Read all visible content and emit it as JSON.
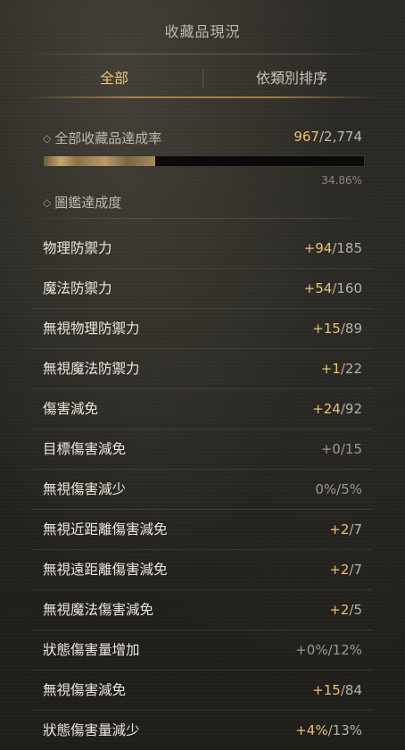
{
  "window": {
    "title": "收藏品現況"
  },
  "tabs": [
    {
      "label": "全部",
      "active": true
    },
    {
      "label": "依類別排序",
      "active": false
    }
  ],
  "collection_rate": {
    "label": "全部收藏品達成率",
    "current": "967",
    "total": "2,774",
    "percent_text": "34.86%",
    "progress": 0.3486
  },
  "codex": {
    "label": "圖鑑達成度"
  },
  "icons": {
    "bullet": "diamond-icon"
  },
  "colors": {
    "accent": "#e9c46e",
    "text": "#ebe6dc",
    "muted": "#9e988c"
  },
  "stats": [
    {
      "name": "物理防禦力",
      "current": "+94",
      "max": "185",
      "highlight": true
    },
    {
      "name": "魔法防禦力",
      "current": "+54",
      "max": "160",
      "highlight": true
    },
    {
      "name": "無視物理防禦力",
      "current": "+15",
      "max": "89",
      "highlight": true
    },
    {
      "name": "無視魔法防禦力",
      "current": "+1",
      "max": "22",
      "highlight": true
    },
    {
      "name": "傷害減免",
      "current": "+24",
      "max": "92",
      "highlight": true
    },
    {
      "name": "目標傷害減免",
      "current": "+0",
      "max": "15",
      "highlight": false
    },
    {
      "name": "無視傷害減少",
      "current": "0%",
      "max": "5%",
      "highlight": false
    },
    {
      "name": "無視近距離傷害減免",
      "current": "+2",
      "max": "7",
      "highlight": true
    },
    {
      "name": "無視遠距離傷害減免",
      "current": "+2",
      "max": "7",
      "highlight": true
    },
    {
      "name": "無視魔法傷害減免",
      "current": "+2",
      "max": "5",
      "highlight": true
    },
    {
      "name": "狀態傷害量增加",
      "current": "+0%",
      "max": "12%",
      "highlight": false
    },
    {
      "name": "無視傷害減免",
      "current": "+15",
      "max": "84",
      "highlight": true
    },
    {
      "name": "狀態傷害量減少",
      "current": "+4%",
      "max": "13%",
      "highlight": true
    }
  ]
}
